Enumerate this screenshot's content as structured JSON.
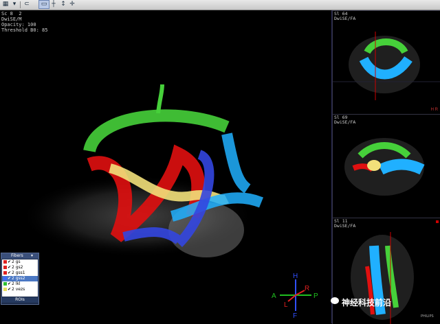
{
  "toolbar": {
    "icons": [
      "layout-icon",
      "grid-icon",
      "link-icon",
      "display-icon",
      "ruler-icon",
      "cursor-icon",
      "crosshair-icon"
    ]
  },
  "main": {
    "info_lines": [
      "Sc 8  2",
      "DwiSE/M",
      "Opacity: 100",
      "Threshold B0: 85"
    ]
  },
  "side_views": [
    {
      "series": "Sl 64",
      "label": "DwiSE/FA",
      "marker": "H  R"
    },
    {
      "series": "Sl 69",
      "label": "DwiSE/FA",
      "marker": ""
    },
    {
      "series": "Sl 11",
      "label": "DwiSE/FA",
      "marker": ""
    }
  ],
  "fibers_panel": {
    "title": "Fibers",
    "items": [
      {
        "label": "2 gs",
        "color": "#e02020",
        "selected": false
      },
      {
        "label": "2 gs2",
        "color": "#e02020",
        "selected": false
      },
      {
        "label": "2 gss1",
        "color": "#e02020",
        "selected": false
      },
      {
        "label": "2 gss2",
        "color": "#3b6cff",
        "selected": true
      },
      {
        "label": "2 lkl",
        "color": "#30c030",
        "selected": false
      },
      {
        "label": "2 vezs",
        "color": "#e8e060",
        "selected": false
      }
    ],
    "rois_label": "ROIs"
  },
  "orientation": {
    "H": "H",
    "F": "F",
    "A": "A",
    "P": "P",
    "R": "R",
    "L": "L"
  },
  "watermark": "神经科技前沿",
  "philips_label": "PHILIPS",
  "colors": {
    "red": "#e01010",
    "blue": "#3346e0",
    "cyan": "#20b0ff",
    "green": "#46d03a",
    "yellow": "#f2e07a"
  }
}
